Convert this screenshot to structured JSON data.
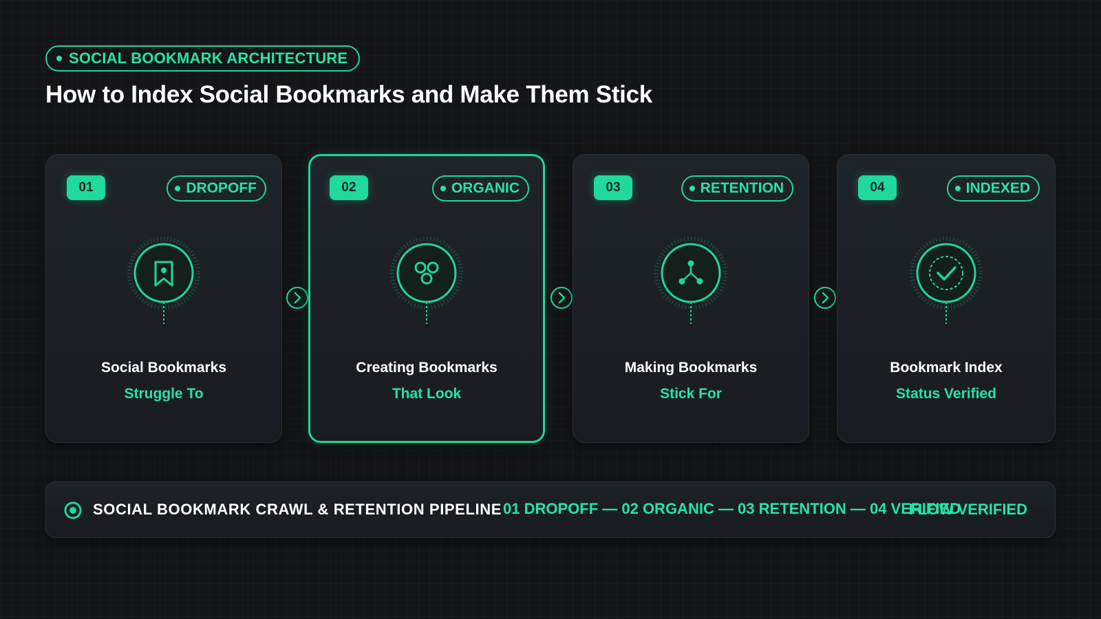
{
  "header": {
    "eyebrow": "SOCIAL BOOKMARK ARCHITECTURE",
    "title": "How to Index Social Bookmarks and Make Them Stick"
  },
  "accent_color": "#1fd69a",
  "background_color": "#141517",
  "cards": [
    {
      "number": "01",
      "tag": "DROPOFF",
      "icon": "bookmark-icon",
      "title": "Social Bookmarks",
      "subtitle": "Struggle To",
      "active": false
    },
    {
      "number": "02",
      "tag": "ORGANIC",
      "icon": "network-cluster-icon",
      "title": "Creating Bookmarks",
      "subtitle": "That Look",
      "active": true
    },
    {
      "number": "03",
      "tag": "RETENTION",
      "icon": "branch-nodes-icon",
      "title": "Making Bookmarks",
      "subtitle": "Stick For",
      "active": false
    },
    {
      "number": "04",
      "tag": "INDEXED",
      "icon": "check-circle-icon",
      "title": "Bookmark Index",
      "subtitle": "Status Verified",
      "active": false
    }
  ],
  "pipeline": {
    "label": "SOCIAL BOOKMARK CRAWL & RETENTION PIPELINE",
    "flow": "01 DROPOFF — 02 ORGANIC — 03 RETENTION — 04 VERIFIED",
    "status": "FLOW VERIFIED"
  }
}
